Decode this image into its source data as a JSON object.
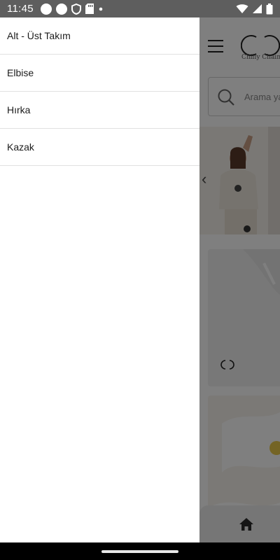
{
  "status_bar": {
    "time": "11:45",
    "icons": [
      "circle-icon",
      "circle-icon",
      "shield-icon",
      "sd-card-icon",
      "dot-icon",
      "wifi-icon",
      "signal-icon",
      "battery-icon"
    ]
  },
  "app": {
    "brand_name": "Chilly Chain",
    "search_placeholder": "Arama yap",
    "bottom_nav_icon": "home-icon"
  },
  "drawer": {
    "items": [
      {
        "label": "Alt - Üst Takım"
      },
      {
        "label": "Elbise"
      },
      {
        "label": "Hırka"
      },
      {
        "label": "Kazak"
      }
    ]
  },
  "colors": {
    "status_bar": "#5e5e5e",
    "drawer_bg": "#ffffff",
    "divider": "#e1e1e1",
    "scrim": "rgba(0,0,0,0.5)"
  }
}
